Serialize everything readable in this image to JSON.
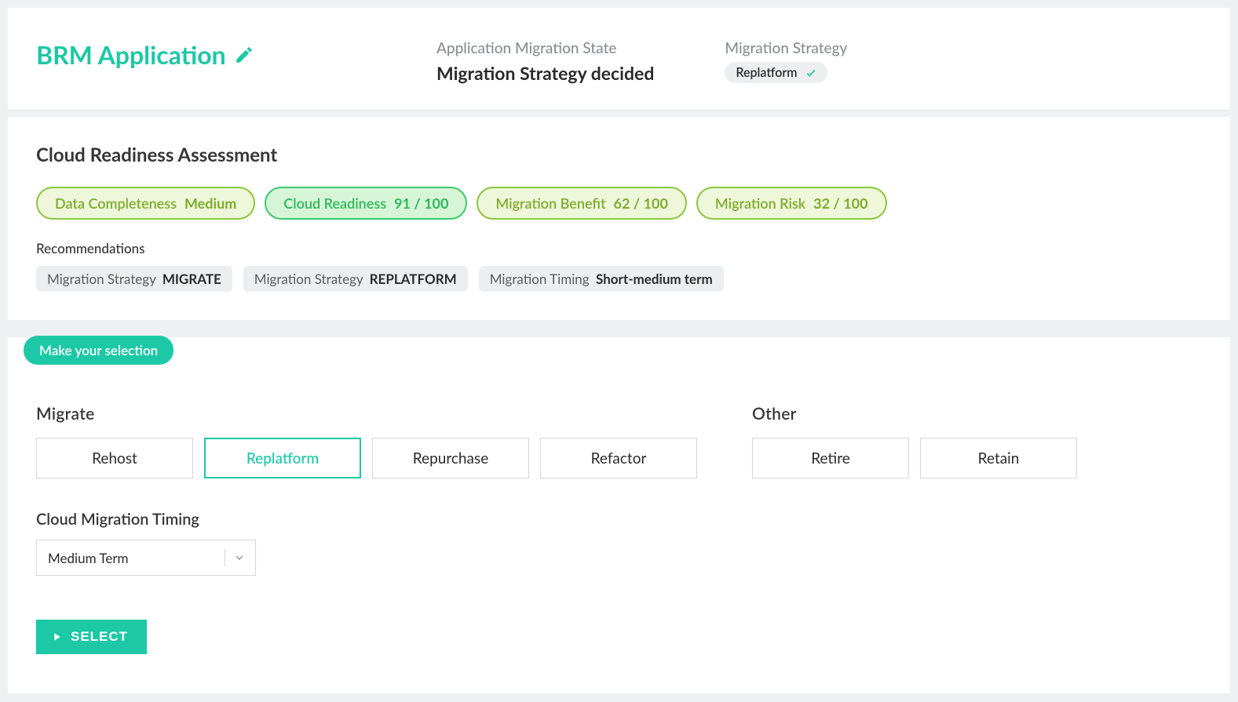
{
  "header": {
    "app_title": "BRM Application",
    "state_label": "Application Migration State",
    "state_value": "Migration Strategy decided",
    "strategy_label": "Migration Strategy",
    "strategy_value": "Replatform"
  },
  "assessment": {
    "title": "Cloud Readiness Assessment",
    "metrics": {
      "data_completeness": {
        "label": "Data Completeness",
        "value": "Medium"
      },
      "cloud_readiness": {
        "label": "Cloud Readiness",
        "value": "91 / 100"
      },
      "migration_benefit": {
        "label": "Migration Benefit",
        "value": "62 / 100"
      },
      "migration_risk": {
        "label": "Migration Risk",
        "value": "32 / 100"
      }
    },
    "recs_title": "Recommendations",
    "recs": {
      "r1": {
        "label": "Migration Strategy",
        "value": "MIGRATE"
      },
      "r2": {
        "label": "Migration Strategy",
        "value": "REPLATFORM"
      },
      "r3": {
        "label": "Migration Timing",
        "value": "Short-medium term"
      }
    }
  },
  "selection": {
    "tab_label": "Make your selection",
    "migrate_group": "Migrate",
    "other_group": "Other",
    "options": {
      "rehost": "Rehost",
      "replatform": "Replatform",
      "repurchase": "Repurchase",
      "refactor": "Refactor",
      "retire": "Retire",
      "retain": "Retain"
    },
    "selected_option": "replatform",
    "timing_label": "Cloud Migration Timing",
    "timing_value": "Medium Term",
    "select_button": "SELECT"
  },
  "colors": {
    "accent": "#1cc8a5",
    "olive": "#8cc63f"
  }
}
